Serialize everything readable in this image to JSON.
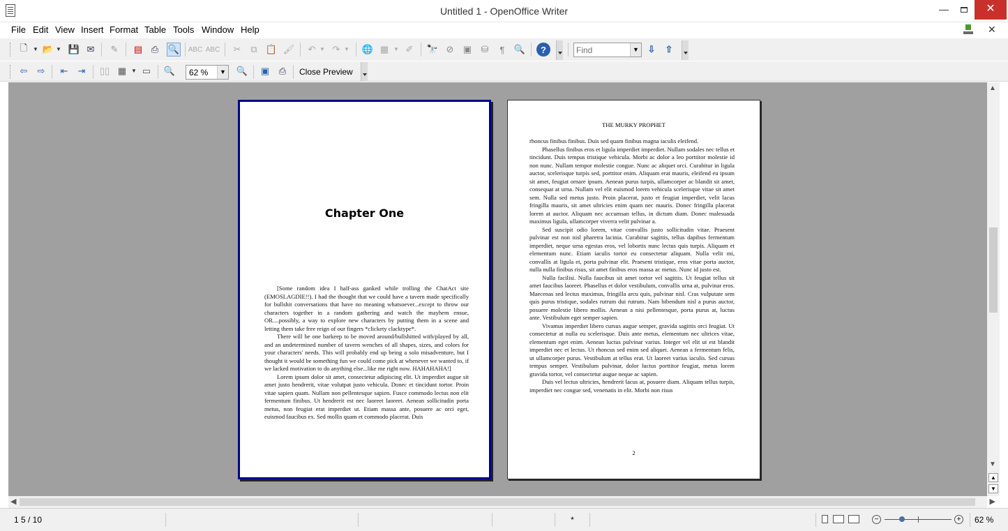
{
  "window": {
    "title": "Untitled 1 - OpenOffice Writer",
    "minimize_glyph": "—",
    "close_glyph": "✕"
  },
  "menu": {
    "items": [
      "File",
      "Edit",
      "View",
      "Insert",
      "Format",
      "Table",
      "Tools",
      "Window",
      "Help"
    ],
    "close_doc_glyph": "✕"
  },
  "toolbar": {
    "find_placeholder": "Find"
  },
  "preview_toolbar": {
    "zoom_value": "62 %",
    "close_preview_label": "Close Preview"
  },
  "pages": {
    "page1": {
      "chapter_title": "Chapter One",
      "paragraphs": [
        "[Some random idea I half-ass ganked while trolling the ChatAct site (EMOSLAGDIE!!). I had the thought that we could have a tavern made specifically for bullshit conversations that have no meaning whatsoever...except to throw our characters together in a random gathering and watch the mayhem ensue, OR....possibly, a way to explore new characters by putting them in a scene and letting them take free reign of our fingers *clickety clacktype*.",
        "There will be one barkeep to be moved around/bullshitted with/played by all, and an undetermined number of tavern wenches of all shapes, sizes, and colors for your characters' needs. This will probably end up being a solo misadventure, but I thought it would be something fun we could come pick at whenever we wanted to, if we lacked motivation to do anything else...like me right now. HAHAHAHA!]",
        "Lorem ipsum dolor sit amet, consectetur adipiscing elit. Ut imperdiet augue sit amet justo hendrerit, vitae volutpat justo vehicula. Donec et tincidunt tortor. Proin vitae sapien quam. Nullam non pellentesque sapien. Fusce commodo lectus non elit fermentum finibus. Ut hendrerit est nec laoreet laoreet. Aenean sollicitudin porta metus, non feugiat erat imperdiet ut. Etiam massa ante, posuere ac orci eget, euismod faucibus ex. Sed mollis quam et commodo placerat. Duis"
      ]
    },
    "page2": {
      "running_head": "THE MURKY PROPHET",
      "first_line": "rhoncus finibus finibus. Duis sed quam finibus magna iaculis eleifend.",
      "paragraphs": [
        "Phasellus finibus eros et ligula imperdiet imperdiet. Nullam sodales nec tellus et tincidunt. Duis tempus tristique vehicula. Morbi ac dolor a leo porttitor molestie id non nunc. Nullam tempor molestie congue. Nunc ac aliquet orci. Curabitur in ligula auctor, scelerisque turpis sed, porttitor enim. Aliquam erat mauris, eleifend eu ipsum sit amet, feugiat ornare ipsum. Aenean purus turpis, ullamcorper ac blandit sit amet, consequat at urna. Nullam vel elit euismod lorem vehicula scelerisque vitae sit amet sem. Nulla sed metus justo. Proin placerat, justo et feugiat imperdiet, velit lacus fringilla mauris, sit amet ultricies enim quam nec mauris. Donec fringilla placerat lorem at auctor. Aliquam nec accumsan tellus, in dictum diam. Donec malesuada maximus ligula, ullamcorper viverra velit pulvinar a.",
        "Sed suscipit odio lorem, vitae convallis justo sollicitudin vitae. Praesent pulvinar est non nisl pharetra lacinia. Curabitur sagittis, tellus dapibus fermentum imperdiet, neque urna egestas eros, vel lobortis nunc lectus quis turpis. Aliquam et elementum nunc. Etiam iaculis tortor eu consectetur aliquam. Nulla velit mi, convallis at ligula et, porta pulvinar elit. Praesent tristique, eros vitae porta auctor, nulla nulla finibus risus, sit amet finibus eros massa ac metus. Nunc id justo est.",
        "Nulla facilisi. Nulla faucibus sit amet tortor vel sagittis. Ut feugiat tellus sit amet faucibus laoreet. Phasellus et dolor vestibulum, convallis urna at, pulvinar eros. Maecenas sed lectus maximus, fringilla arcu quis, pulvinar nisl. Cras vulputate sem quis purus tristique, sodales rutrum dui rutrum. Nam bibendum nisl a purus auctor, posuere molestie libero mollis. Aenean a nisi pellentesque, porta purus at, luctus ante. Vestibulum eget semper sapien.",
        "Vivamus imperdiet libero cursus augue semper, gravida sagittis orci feugiat. Ut consectetur at nulla eu scelerisque. Duis ante metus, elementum nec ultrices vitae, elementum eget enim. Aenean luctus pulvinar varius. Integer vel elit ut est blandit imperdiet nec et lectus. Ut rhoncus sed enim sed aliquet. Aenean a fermentum felis, ut ullamcorper purus. Vestibulum at tellus erat. Ut laoreet varius iaculis. Sed cursus tempus semper. Vestibulum pulvinar, dolor luctus porttitor feugiat, metus lorem gravida tortor, vel consectetur augue neque ac sapien.",
        "Duis vel lectus ultricies, hendrerit lacus at, posuere diam. Aliquam tellus turpis, imperdiet nec congue sed, venenatis in elit. Morbi non risus"
      ],
      "page_number": "2"
    }
  },
  "statusbar": {
    "page_info": "1 5 / 10",
    "modified_marker": "*",
    "zoom_label": "62 %",
    "zoom_level_fraction": 0.62
  },
  "colors": {
    "page_border_active": "#00008b",
    "close_button": "#c9302c",
    "workspace": "#a0a0a0"
  }
}
